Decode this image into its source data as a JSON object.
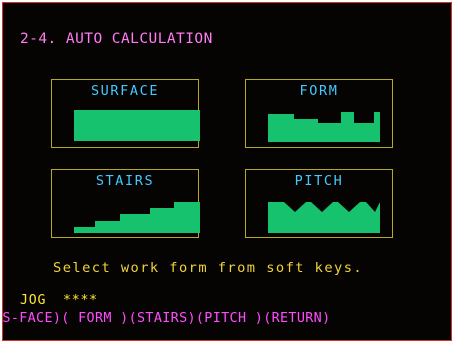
{
  "screen": {
    "title": "2-4. AUTO CALCULATION",
    "message": "Select work form from soft keys.",
    "jog_label": "JOG",
    "jog_value": "****",
    "colors": {
      "background": "#050403",
      "frame": "#b7aa22",
      "title": "#ff7cf2",
      "panel_label": "#42c9ff",
      "shape_fill": "#16c26e",
      "message": "#f2d23b",
      "jog": "#ffe82f",
      "softkeys": "#ff4cff",
      "outer_border": "#d4322b"
    }
  },
  "panels": [
    {
      "label": "SURFACE",
      "icon": "surface-block-icon"
    },
    {
      "label": "FORM",
      "icon": "form-profile-icon"
    },
    {
      "label": "STAIRS",
      "icon": "stairs-profile-icon"
    },
    {
      "label": "PITCH",
      "icon": "pitch-profile-icon"
    }
  ],
  "softkeys": [
    "(S-FACE)",
    "( FORM )",
    "(STAIRS)",
    "(PITCH )",
    "(RETURN)"
  ]
}
